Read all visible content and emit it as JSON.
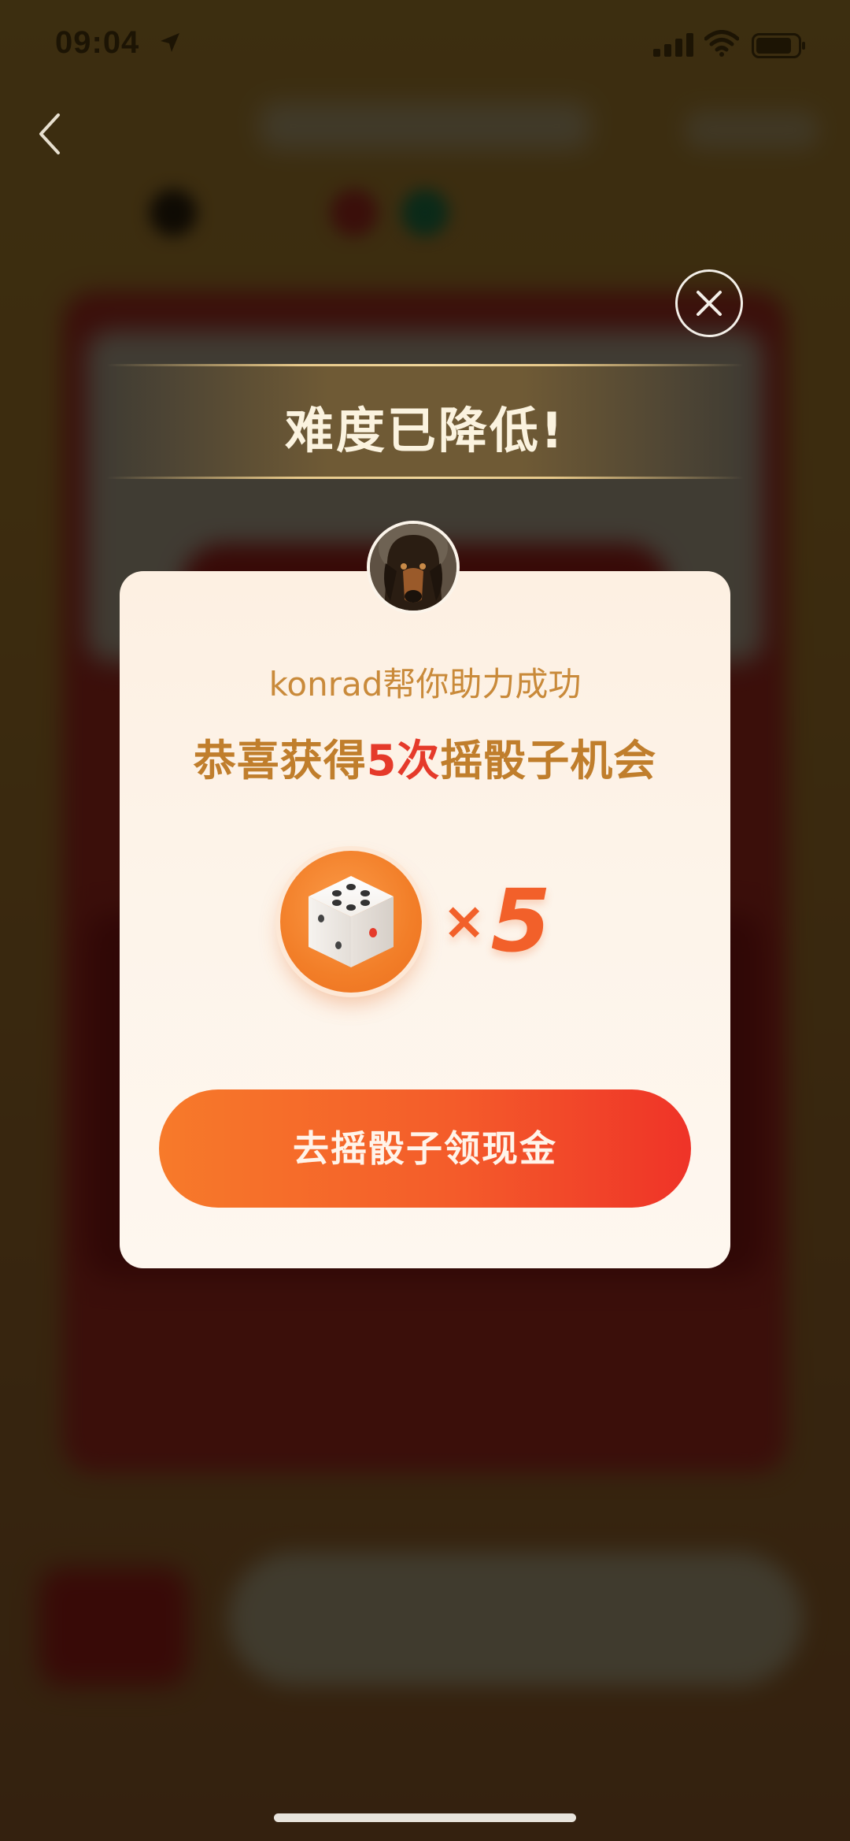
{
  "status_bar": {
    "time": "09:04"
  },
  "modal": {
    "banner_title": "难度已降低!",
    "subtitle": "konrad帮你助力成功",
    "headline_prefix": "恭喜获得",
    "headline_highlight": "5次",
    "headline_suffix": "摇骰子机会",
    "reward_times_symbol": "×",
    "reward_count": "5",
    "cta_label": "去摇骰子领现金"
  },
  "icons": {
    "back": "chevron-left-icon",
    "close": "close-icon",
    "dice": "dice-icon",
    "signal": "signal-icon",
    "wifi": "wifi-icon",
    "battery": "battery-icon",
    "location": "location-arrow-icon"
  },
  "colors": {
    "accent_orange": "#f45c2a",
    "highlight_red": "#e53a2a",
    "headline_gold": "#c07e2c",
    "card_bg": "#fdf0e2"
  }
}
